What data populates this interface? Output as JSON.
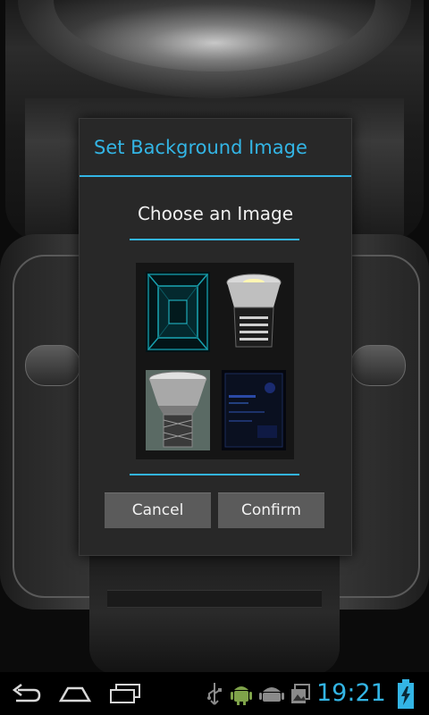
{
  "dialog": {
    "title": "Set Background Image",
    "prompt": "Choose an Image",
    "thumbnails": [
      {
        "name": "teal-corridor-thumbnail"
      },
      {
        "name": "flashlight-bulb-thumbnail"
      },
      {
        "name": "flashlight-head-thumbnail"
      },
      {
        "name": "dark-blue-thumbnail"
      }
    ],
    "cancel_label": "Cancel",
    "confirm_label": "Confirm"
  },
  "status_bar": {
    "time": "19:21",
    "icons": [
      "usb-icon",
      "android-icon",
      "android-icon",
      "photo-icon",
      "battery-charging-icon"
    ]
  },
  "nav_bar": {
    "icons": [
      "back-icon",
      "home-icon",
      "recent-apps-icon"
    ]
  },
  "colors": {
    "accent": "#33b5e5",
    "dialog_background": "#282828",
    "button_background": "#5b5b5b"
  }
}
